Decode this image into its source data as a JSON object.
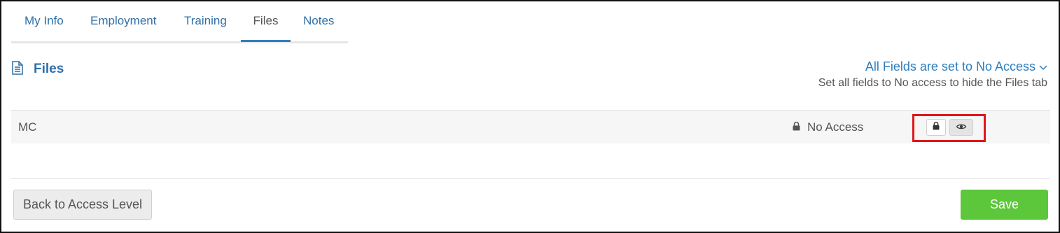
{
  "tabs": [
    {
      "label": "My Info"
    },
    {
      "label": "Employment"
    },
    {
      "label": "Training"
    },
    {
      "label": "Files",
      "active": true
    },
    {
      "label": "Notes"
    }
  ],
  "section": {
    "title": "Files",
    "icon": "document-icon"
  },
  "access": {
    "link_label": "All Fields are set to No Access",
    "hint": "Set all fields to No access to hide the Files tab"
  },
  "rows": [
    {
      "label": "MC",
      "status": "No Access"
    }
  ],
  "footer": {
    "back_label": "Back to Access Level",
    "save_label": "Save"
  },
  "colors": {
    "link": "#2f7fbf",
    "save": "#5cc73a",
    "highlight": "#e0161b"
  }
}
